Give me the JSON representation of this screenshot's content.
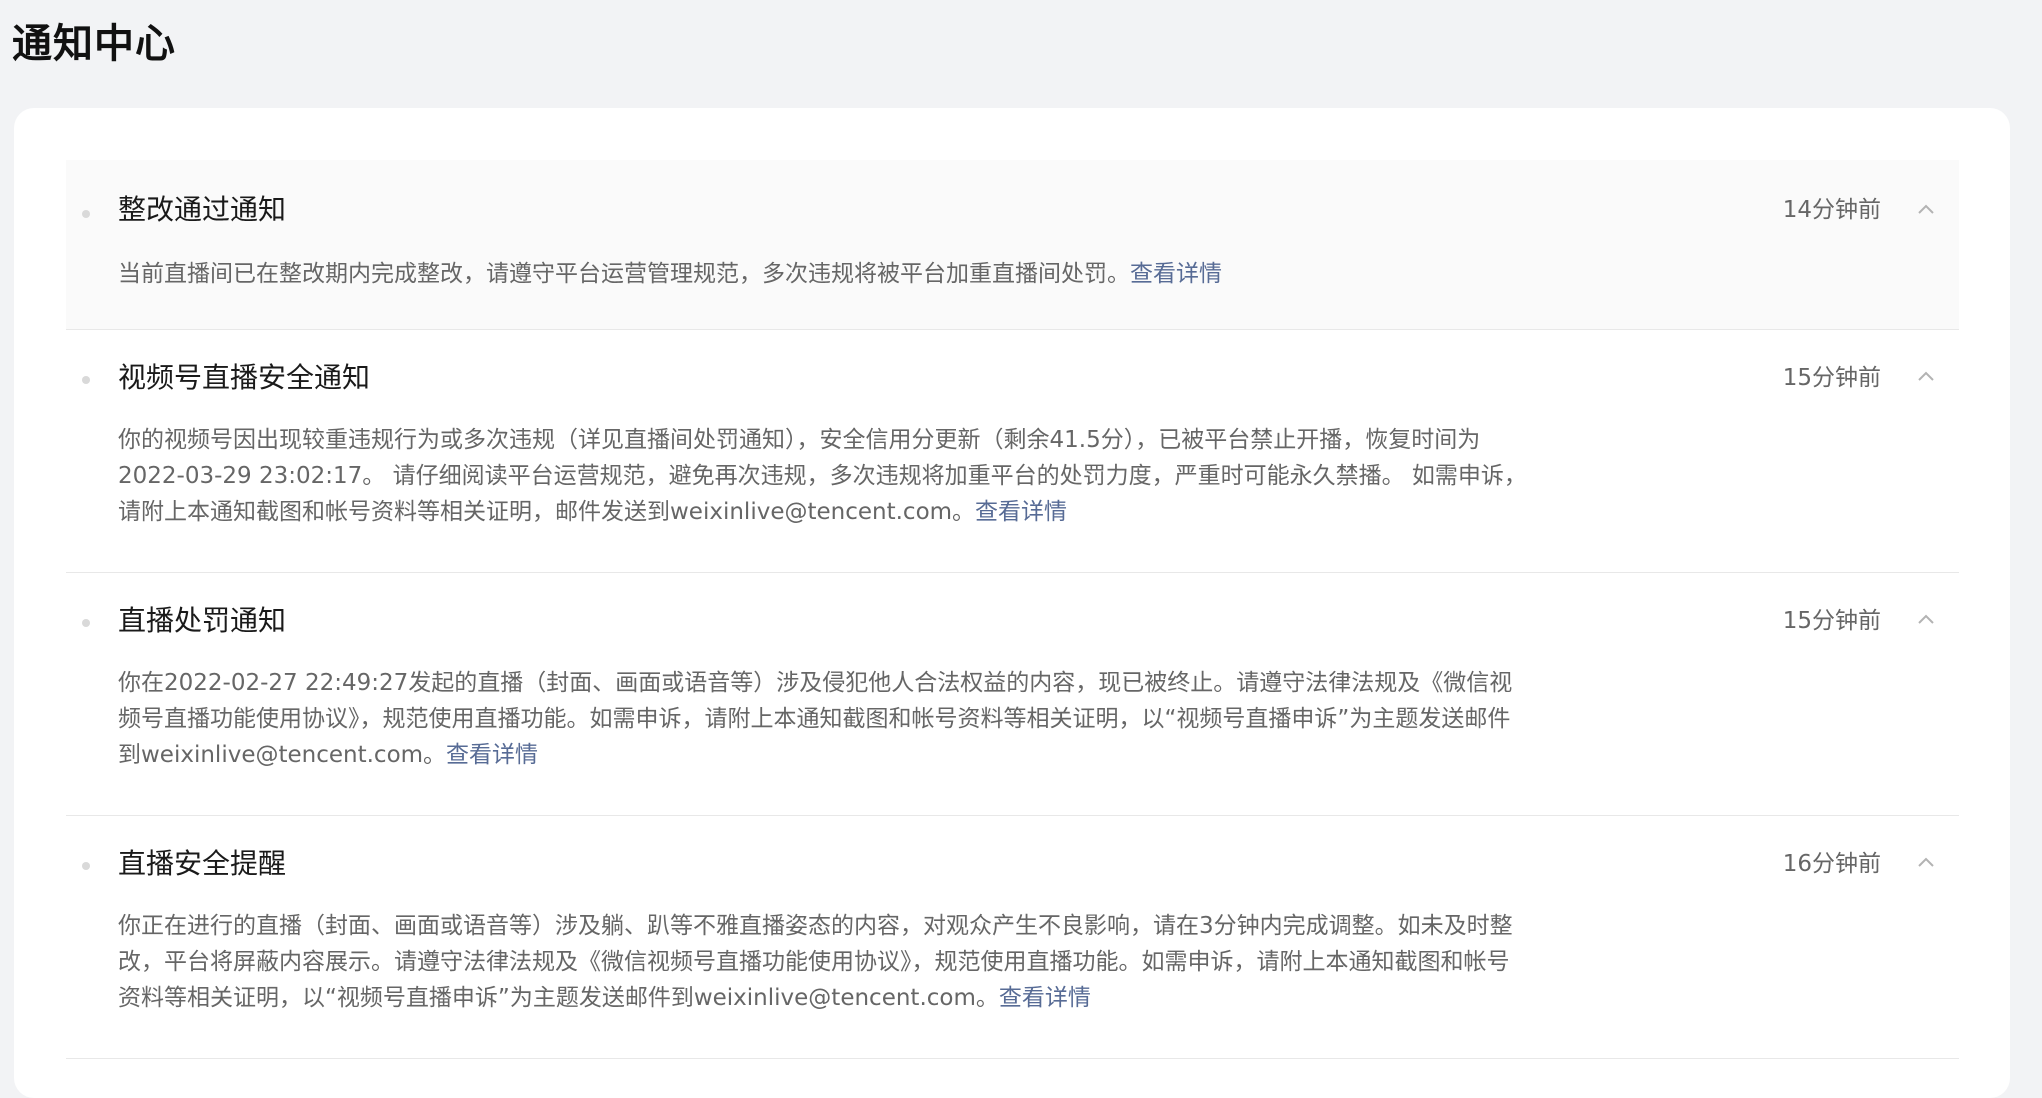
{
  "page": {
    "title": "通知中心"
  },
  "notifications": [
    {
      "title": "整改通过通知",
      "time": "14分钟前",
      "body": "当前直播间已在整改期内完成整改，请遵守平台运营管理规范，多次违规将被平台加重直播间处罚。",
      "link": "查看详情"
    },
    {
      "title": "视频号直播安全通知",
      "time": "15分钟前",
      "body": "你的视频号因出现较重违规行为或多次违规（详见直播间处罚通知），安全信用分更新（剩余41.5分），已被平台禁止开播，恢复时间为2022-03-29 23:02:17。 请仔细阅读平台运营规范，避免再次违规，多次违规将加重平台的处罚力度，严重时可能永久禁播。 如需申诉，请附上本通知截图和帐号资料等相关证明，邮件发送到weixinlive@tencent.com。",
      "link": "查看详情"
    },
    {
      "title": "直播处罚通知",
      "time": "15分钟前",
      "body": "你在2022-02-27 22:49:27发起的直播（封面、画面或语音等）涉及侵犯他人合法权益的内容，现已被终止。请遵守法律法规及《微信视频号直播功能使用协议》，规范使用直播功能。如需申诉，请附上本通知截图和帐号资料等相关证明，以“视频号直播申诉”为主题发送邮件到weixinlive@tencent.com。",
      "link": "查看详情"
    },
    {
      "title": "直播安全提醒",
      "time": "16分钟前",
      "body": "你正在进行的直播（封面、画面或语音等）涉及躺、趴等不雅直播姿态的内容，对观众产生不良影响，请在3分钟内完成调整。如未及时整改，平台将屏蔽内容展示。请遵守法律法规及《微信视频号直播功能使用协议》，规范使用直播功能。如需申诉，请附上本通知截图和帐号资料等相关证明，以“视频号直播申诉”为主题发送邮件到weixinlive@tencent.com。",
      "link": "查看详情"
    }
  ],
  "icons": {
    "bullet": "bullet-dot-icon",
    "collapse": "chevron-up-icon"
  },
  "colors": {
    "link": "#576b95",
    "background": "#f2f3f5",
    "card": "#ffffff",
    "highlight_row": "#fafafa"
  }
}
